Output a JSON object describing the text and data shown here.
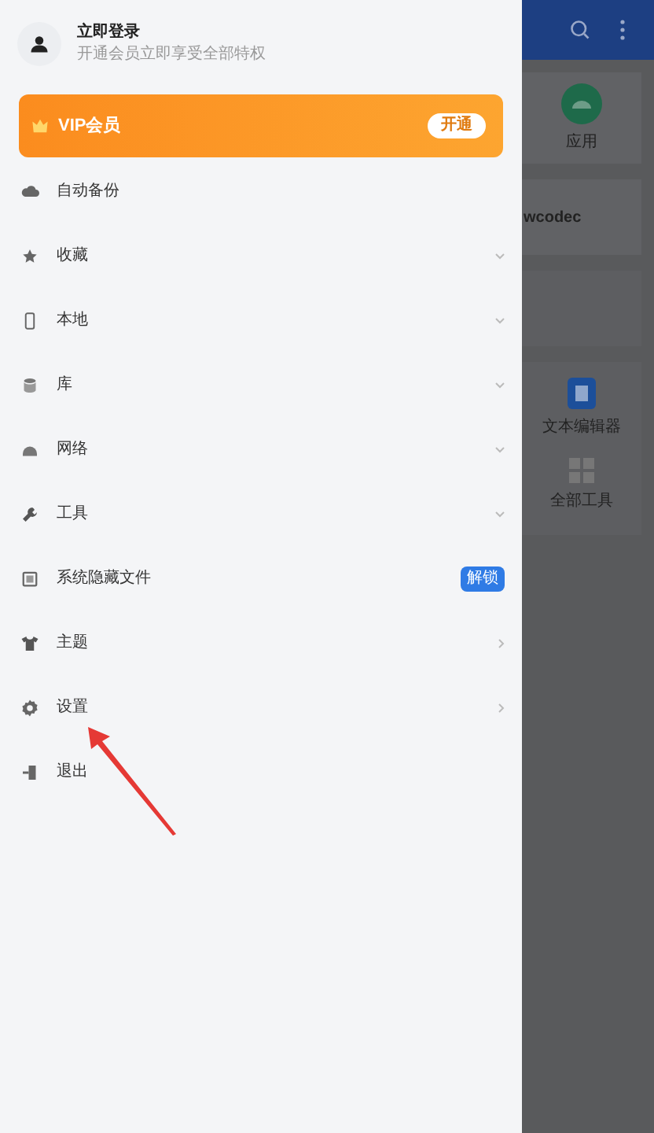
{
  "drawer": {
    "account": {
      "title": "立即登录",
      "subtitle": "开通会员立即享受全部特权"
    },
    "vip": {
      "label": "VIP会员",
      "button": "开通"
    },
    "items": [
      {
        "label": "自动备份",
        "kind": "plain"
      },
      {
        "label": "收藏",
        "kind": "expand"
      },
      {
        "label": "本地",
        "kind": "expand"
      },
      {
        "label": "库",
        "kind": "expand"
      },
      {
        "label": "网络",
        "kind": "expand"
      },
      {
        "label": "工具",
        "kind": "expand"
      },
      {
        "label": "系统隐藏文件",
        "kind": "badge",
        "badge": "解锁"
      },
      {
        "label": "主题",
        "kind": "arrow"
      },
      {
        "label": "设置",
        "kind": "arrow"
      },
      {
        "label": "退出",
        "kind": "plain"
      }
    ]
  },
  "background": {
    "tiles": [
      {
        "kind": "app",
        "label": "应用"
      },
      {
        "kind": "text",
        "label": "wcodec"
      },
      {
        "kind": "empty"
      },
      {
        "kind": "tools",
        "labels": [
          "文本编辑器",
          "全部工具"
        ]
      }
    ]
  }
}
